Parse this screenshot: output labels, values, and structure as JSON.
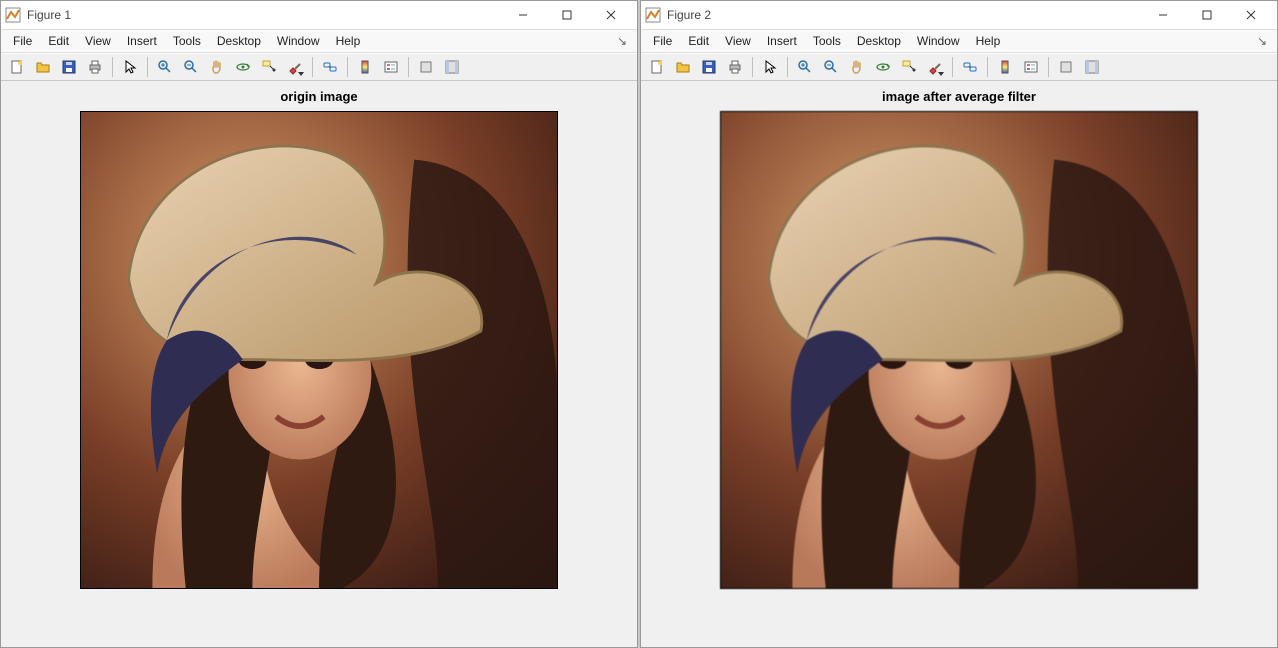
{
  "figures": [
    {
      "window_title": "Figure 1",
      "plot_title": "origin image",
      "image_label": "Image content (origin)"
    },
    {
      "window_title": "Figure 2",
      "plot_title": "image after average filter",
      "image_label": "Image content (average-filtered)"
    }
  ],
  "menu": {
    "file": "File",
    "edit": "Edit",
    "view": "View",
    "insert": "Insert",
    "tools": "Tools",
    "desktop": "Desktop",
    "window": "Window",
    "help": "Help",
    "dock_marker": "↘"
  },
  "toolbar_icons": {
    "new": "new-figure-icon",
    "open": "open-file-icon",
    "save": "save-icon",
    "print": "print-icon",
    "pointer": "pointer-icon",
    "zoom_in": "zoom-in-icon",
    "zoom_out": "zoom-out-icon",
    "pan": "pan-icon",
    "rotate": "rotate-3d-icon",
    "datatip": "data-cursor-icon",
    "brush": "brush-icon",
    "link": "link-plot-icon",
    "colorbar": "colorbar-icon",
    "legend": "legend-icon",
    "hide_tools": "hide-plot-tools-icon",
    "show_tools": "show-plot-tools-icon"
  }
}
